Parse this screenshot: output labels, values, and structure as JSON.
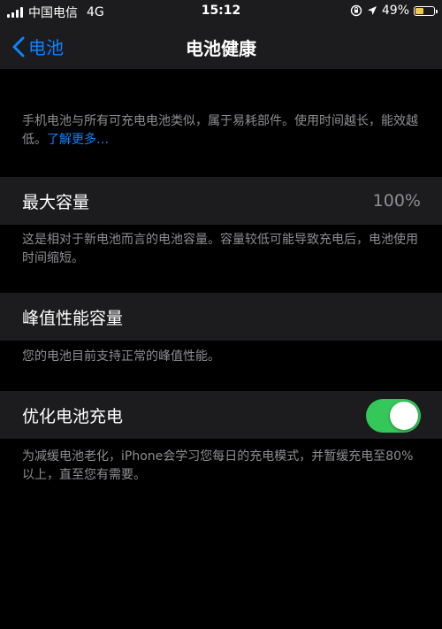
{
  "status_bar": {
    "carrier": "中国电信",
    "network": "4G",
    "time": "15:12",
    "battery_percent": "49%",
    "battery_level": 0.49,
    "icons": [
      "signal-bars-icon",
      "orientation-lock-icon",
      "location-arrow-icon",
      "battery-icon"
    ]
  },
  "nav": {
    "back_label": "电池",
    "title": "电池健康"
  },
  "intro": {
    "text": "手机电池与所有可充电电池类似，属于易耗部件。使用时间越长，能效越低。",
    "link": "了解更多…"
  },
  "max_capacity": {
    "label": "最大容量",
    "value": "100%",
    "description": "这是相对于新电池而言的电池容量。容量较低可能导致充电后，电池使用时间缩短。"
  },
  "peak_performance": {
    "label": "峰值性能容量",
    "description": "您的电池目前支持正常的峰值性能。"
  },
  "optimized_charging": {
    "label": "优化电池充电",
    "enabled": true,
    "description": "为减缓电池老化，iPhone会学习您每日的充电模式，并暂缓充电至80%以上，直至您有需要。"
  },
  "colors": {
    "accent": "#0a84ff",
    "toggle_on": "#34c759",
    "battery_fill": "#f2c94c",
    "cell_bg": "#1c1c1e",
    "secondary_text": "#8e8e93"
  }
}
